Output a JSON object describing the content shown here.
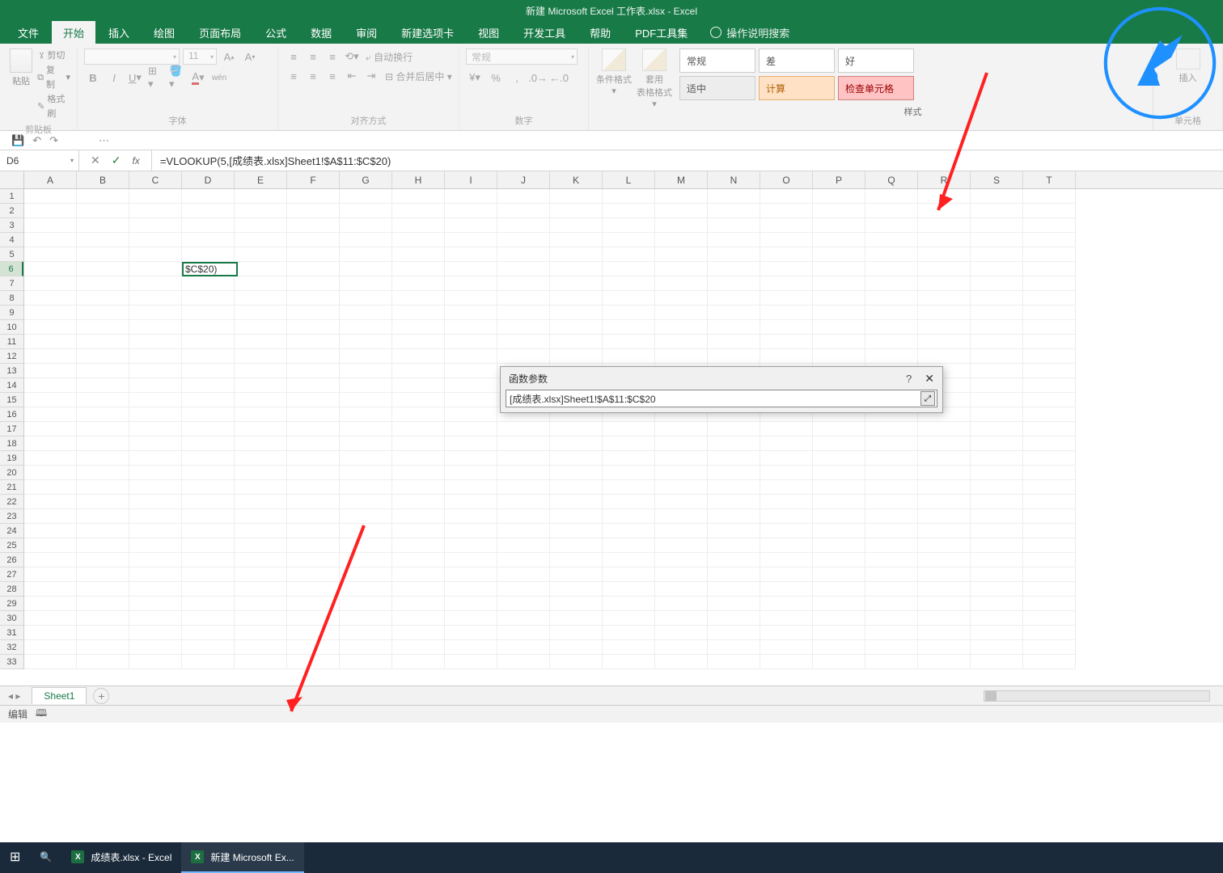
{
  "title": "新建 Microsoft Excel 工作表.xlsx  -  Excel",
  "tabs": [
    "文件",
    "开始",
    "插入",
    "绘图",
    "页面布局",
    "公式",
    "数据",
    "审阅",
    "新建选项卡",
    "视图",
    "开发工具",
    "帮助",
    "PDF工具集"
  ],
  "tell_me": "操作说明搜索",
  "clipboard": {
    "paste": "粘贴",
    "cut": "剪切",
    "copy": "复制",
    "painter": "格式刷",
    "label": "剪贴板"
  },
  "font": {
    "size": "11",
    "label": "字体"
  },
  "align": {
    "wrap": "自动换行",
    "merge": "合并后居中",
    "label": "对齐方式"
  },
  "number": {
    "format": "常规",
    "label": "数字"
  },
  "styles": {
    "cond": "条件格式",
    "table": "套用\n表格格式",
    "label": "样式",
    "gallery": [
      [
        "常规",
        "差",
        "好"
      ],
      [
        "适中",
        "计算",
        "检查单元格"
      ]
    ]
  },
  "cells": {
    "insert": "插入",
    "label": "单元格"
  },
  "name_box": "D6",
  "formula": "=VLOOKUP(5,[成绩表.xlsx]Sheet1!$A$11:$C$20)",
  "columns": [
    "A",
    "B",
    "C",
    "D",
    "E",
    "F",
    "G",
    "H",
    "I",
    "J",
    "K",
    "L",
    "M",
    "N",
    "O",
    "P",
    "Q",
    "R",
    "S",
    "T"
  ],
  "rows": [
    "1",
    "2",
    "3",
    "4",
    "5",
    "6",
    "7",
    "8",
    "9",
    "10",
    "11",
    "12",
    "13",
    "14",
    "15",
    "16",
    "17",
    "18",
    "19",
    "20",
    "21",
    "22",
    "23",
    "24",
    "25",
    "26",
    "27",
    "28",
    "29",
    "30",
    "31",
    "32",
    "33"
  ],
  "active_cell": {
    "row": 6,
    "col": "D",
    "value": "$C$20)"
  },
  "dialog": {
    "title": "函数参数",
    "value": "[成绩表.xlsx]Sheet1!$A$11:$C$20"
  },
  "sheet_tab": "Sheet1",
  "status": "编辑",
  "taskbar": {
    "app1": "成绩表.xlsx - Excel",
    "app2": "新建 Microsoft Ex..."
  }
}
